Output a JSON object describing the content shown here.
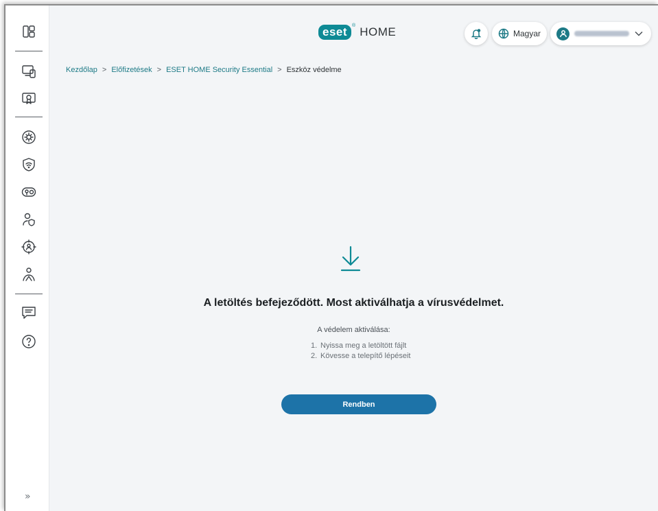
{
  "header": {
    "logo_text": "eset",
    "logo_reg": "®",
    "product": "HOME",
    "language": "Magyar",
    "user_email_blurred": ""
  },
  "breadcrumb": {
    "items": [
      "Kezdőlap",
      "Előfizetések",
      "ESET HOME Security Essential"
    ],
    "current": "Eszköz védelme",
    "separator": ">"
  },
  "content": {
    "headline": "A letöltés befejeződött. Most aktiválhatja a vírusvédelmet.",
    "steps_title": "A védelem aktiválása:",
    "steps": [
      {
        "num": "1.",
        "text": "Nyissa meg a letöltött fájlt"
      },
      {
        "num": "2.",
        "text": "Kövesse a telepítő lépéseit"
      }
    ],
    "ok_button": "Rendben"
  },
  "sidebar": {
    "items": [
      "dashboard-icon",
      "devices-icon",
      "license-icon",
      "settings-icon",
      "wifi-shield-icon",
      "password-manager-icon",
      "identity-protection-icon",
      "antitheft-icon",
      "family-icon",
      "feedback-icon",
      "help-icon"
    ],
    "expand_glyph": "»"
  },
  "colors": {
    "accent": "#0e8a95",
    "primary_button": "#1d73a8",
    "background": "#f3f5f7"
  }
}
